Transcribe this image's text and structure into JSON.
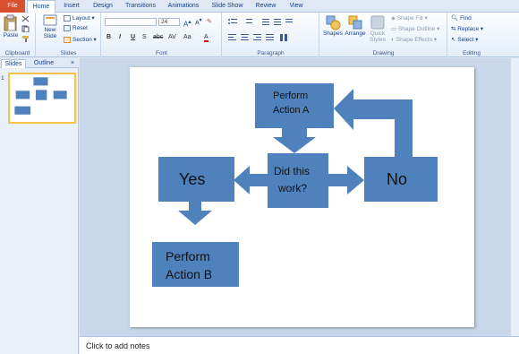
{
  "tabs": [
    "File",
    "Home",
    "Insert",
    "Design",
    "Transitions",
    "Animations",
    "Slide Show",
    "Review",
    "View"
  ],
  "ribbon": {
    "clipboard": {
      "label": "Clipboard",
      "paste": "Paste"
    },
    "slides": {
      "label": "Slides",
      "new_slide": "New",
      "new_slide2": "Slide",
      "layout": "Layout",
      "reset": "Reset",
      "section": "Section"
    },
    "font": {
      "label": "Font",
      "size": "24",
      "bold": "B",
      "italic": "I",
      "underline": "U",
      "strike": "S",
      "shadow": "abc",
      "spacing": "AV",
      "case": "Aa",
      "color": "A"
    },
    "paragraph": {
      "label": "Paragraph"
    },
    "drawing": {
      "label": "Drawing",
      "shapes": "Shapes",
      "arrange": "Arrange",
      "quick_styles": "Quick",
      "quick_styles2": "Styles",
      "shape_fill": "Shape Fill",
      "shape_outline": "Shape Outline",
      "shape_effects": "Shape Effects"
    },
    "editing": {
      "label": "Editing",
      "find": "Find",
      "replace": "Replace",
      "select": "Select"
    }
  },
  "pane": {
    "tabs": [
      "Slides",
      "Outline"
    ],
    "close": "×",
    "slide_number": "1"
  },
  "slide": {
    "box1_line1": "Perform",
    "box1_line2": "Action A",
    "box2_line1": "Did this",
    "box2_line2": "work?",
    "yes": "Yes",
    "no": "No",
    "box5_line1": "Perform",
    "box5_line2": "Action B"
  },
  "notes": {
    "placeholder": "Click to add notes"
  },
  "colors": {
    "shape_fill": "#4f81bd",
    "file_tab": "#d8502e"
  }
}
